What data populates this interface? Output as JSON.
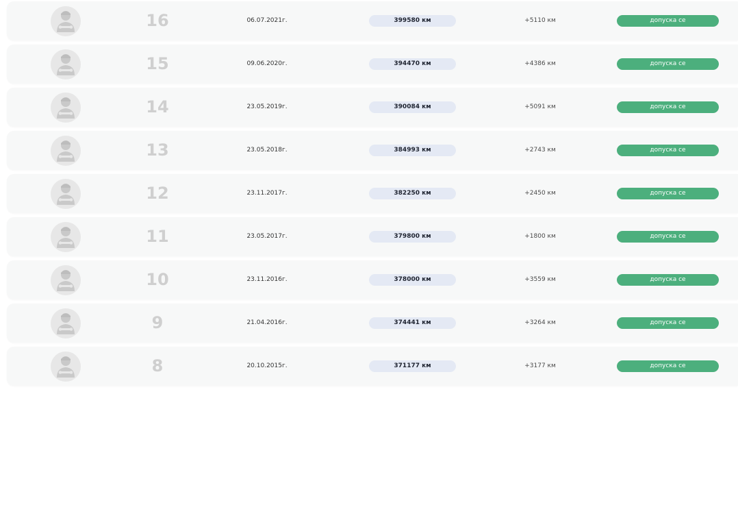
{
  "rows": [
    {
      "number": "16",
      "date": "06.07.2021г.",
      "mileage": "399580 км",
      "delta": "+5110 км",
      "status": "допуска се"
    },
    {
      "number": "15",
      "date": "09.06.2020г.",
      "mileage": "394470 км",
      "delta": "+4386 км",
      "status": "допуска се"
    },
    {
      "number": "14",
      "date": "23.05.2019г.",
      "mileage": "390084 км",
      "delta": "+5091 км",
      "status": "допуска се"
    },
    {
      "number": "13",
      "date": "23.05.2018г.",
      "mileage": "384993 км",
      "delta": "+2743 км",
      "status": "допуска се"
    },
    {
      "number": "12",
      "date": "23.11.2017г.",
      "mileage": "382250 км",
      "delta": "+2450 км",
      "status": "допуска се"
    },
    {
      "number": "11",
      "date": "23.05.2017г.",
      "mileage": "379800 км",
      "delta": "+1800 км",
      "status": "допуска се"
    },
    {
      "number": "10",
      "date": "23.11.2016г.",
      "mileage": "378000 км",
      "delta": "+3559 км",
      "status": "допуска се"
    },
    {
      "number": "9",
      "date": "21.04.2016г.",
      "mileage": "374441 км",
      "delta": "+3264 км",
      "status": "допуска се"
    },
    {
      "number": "8",
      "date": "20.10.2015г.",
      "mileage": "371177 км",
      "delta": "+3177 км",
      "status": "допуска се"
    }
  ],
  "icons": {
    "avatar": "mechanic-avatar-icon"
  },
  "colors": {
    "status_ok": "#4caf7d",
    "mileage_pill": "#e4e9f4",
    "row_bg": "#f7f8f8"
  }
}
